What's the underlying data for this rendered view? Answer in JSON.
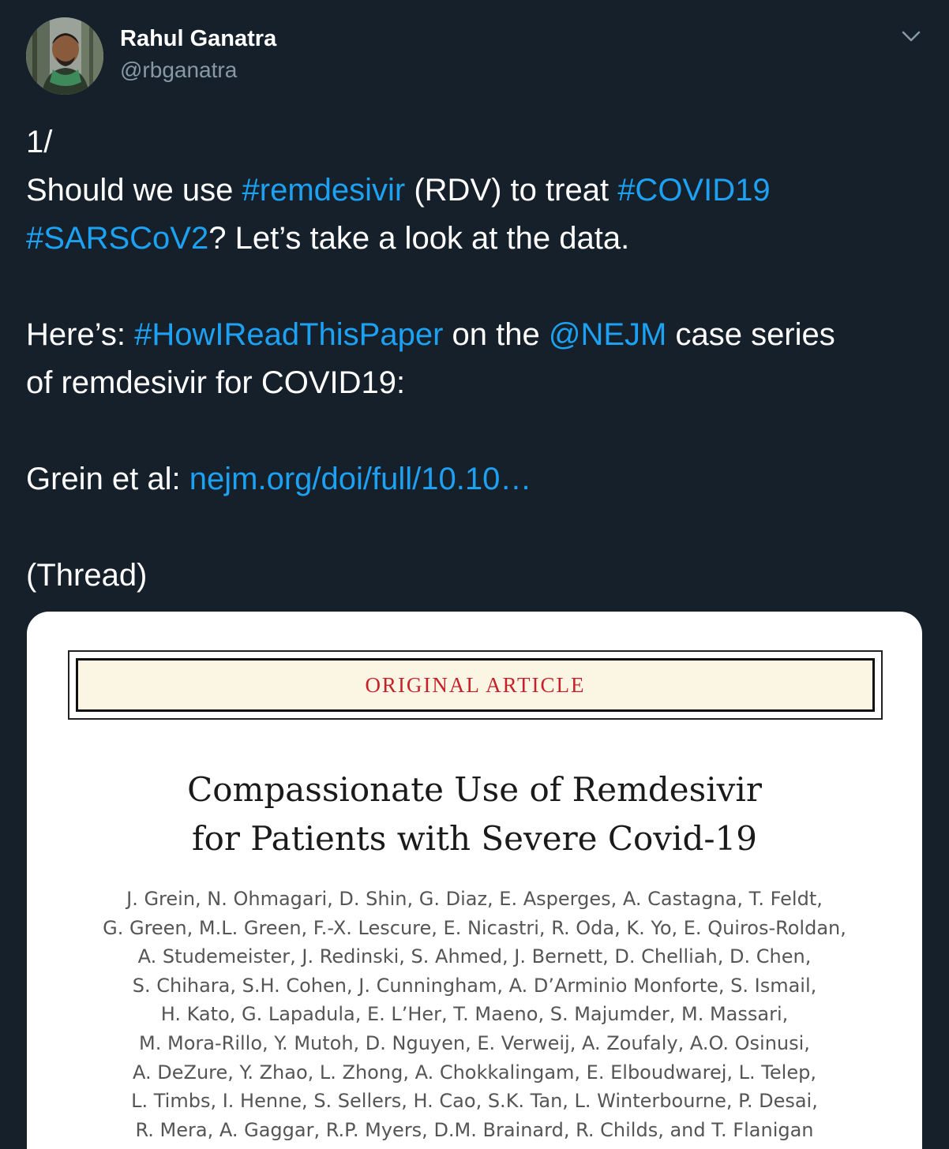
{
  "user": {
    "display_name": "Rahul Ganatra",
    "handle": "@rbganatra"
  },
  "icons": {
    "menu": "chevron-down-icon",
    "avatar": "profile-photo"
  },
  "colors": {
    "background": "#15202b",
    "text": "#ffffff",
    "secondary_text": "#8899a6",
    "link": "#1da1f2",
    "banner_text": "#c8202a"
  },
  "tweet": {
    "line1": "1/",
    "line2_pre": "Should we use ",
    "line2_tag1": "#remdesivir",
    "line2_mid": " (RDV) to treat ",
    "line2_tag2": "#COVID19",
    "line3_tag": "#SARSCoV2",
    "line3_post": "? Let’s take a look at the data.",
    "line5_pre": "Here’s: ",
    "line5_tag": "#HowIReadThisPaper",
    "line5_mid": " on the ",
    "line5_mention": "@NEJM",
    "line5_post": " case series",
    "line6": "of remdesivir for COVID19:",
    "line8_pre": "Grein et al: ",
    "line8_link": "nejm.org/doi/full/10.10…",
    "line10": "(Thread)"
  },
  "media": {
    "banner": "ORIGINAL ARTICLE",
    "title_lines": [
      "Compassionate Use of Remdesivir",
      "for Patients with Severe Covid-19"
    ],
    "author_lines": [
      "J. Grein, N. Ohmagari, D. Shin, G. Diaz, E. Asperges, A. Castagna, T. Feldt,",
      "G. Green, M.L. Green, F.-X. Lescure, E. Nicastri, R. Oda, K. Yo, E. Quiros-Roldan,",
      "A. Studemeister, J. Redinski, S. Ahmed, J. Bernett, D. Chelliah, D. Chen,",
      "S. Chihara, S.H. Cohen, J. Cunningham, A. D’Arminio Monforte, S. Ismail,",
      "H. Kato, G. Lapadula, E. L’Her, T. Maeno, S. Majumder, M. Massari,",
      "M. Mora-Rillo, Y. Mutoh, D. Nguyen, E. Verweij, A. Zoufaly, A.O. Osinusi,",
      "A. DeZure, Y. Zhao, L. Zhong, A. Chokkalingam, E. Elboudwarej, L. Telep,",
      "L. Timbs, I. Henne, S. Sellers, H. Cao, S.K. Tan, L. Winterbourne, P. Desai,",
      "R. Mera, A. Gaggar, R.P. Myers, D.M. Brainard, R. Childs, and T. Flanigan"
    ]
  }
}
